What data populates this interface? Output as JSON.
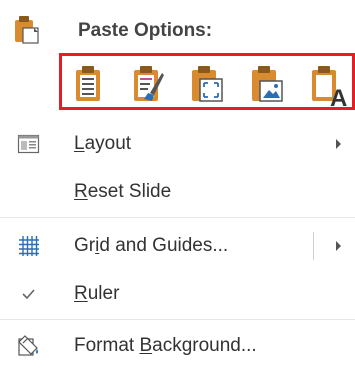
{
  "menu": {
    "header_title": "Paste Options:",
    "paste_options": [
      {
        "name": "use-destination-theme-icon"
      },
      {
        "name": "keep-source-formatting-icon"
      },
      {
        "name": "picture-icon"
      },
      {
        "name": "embed-icon"
      },
      {
        "name": "keep-text-only-icon"
      }
    ],
    "items": [
      {
        "pre": "",
        "key": "L",
        "post": "ayout",
        "icon": "layout-icon",
        "submenu": true
      },
      {
        "pre": "",
        "key": "R",
        "post": "eset Slide",
        "icon": "",
        "submenu": false
      },
      {
        "pre": "Gr",
        "key": "i",
        "post": "d and Guides...",
        "icon": "grid-icon",
        "submenu": true
      },
      {
        "pre": "",
        "key": "R",
        "post": "uler",
        "icon": "checkmark-icon",
        "submenu": false
      },
      {
        "pre": "Format ",
        "key": "B",
        "post": "ackground...",
        "icon": "format-background-icon",
        "submenu": false
      }
    ]
  },
  "colors": {
    "highlight_border": "#e81c24",
    "icon_orange": "#d88b2f",
    "icon_blue": "#2b6fb2",
    "text": "#333333"
  }
}
